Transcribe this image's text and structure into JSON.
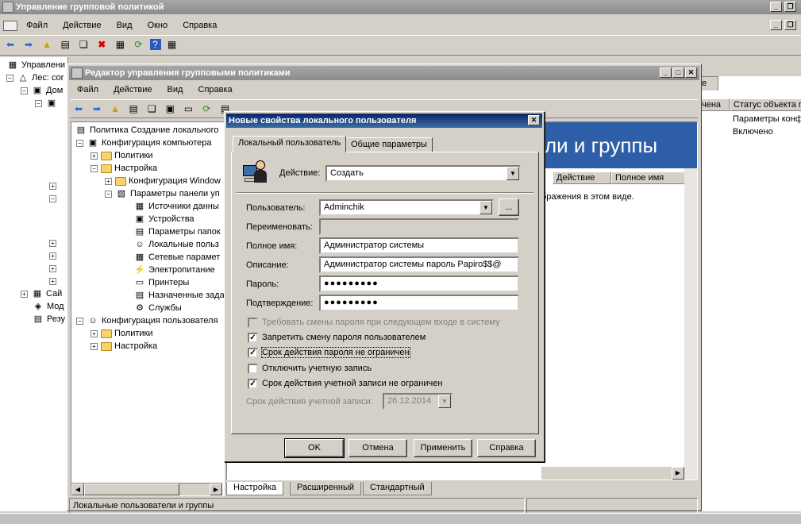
{
  "outer_window": {
    "title": "Управление групповой политикой",
    "menu": [
      "Файл",
      "Действие",
      "Вид",
      "Окно",
      "Справка"
    ],
    "tree": [
      "Управлени",
      "Лес: cor",
      "Дом",
      "Сай",
      "Мод",
      "Резу"
    ],
    "right_tab_fragment": "е",
    "right_columns": [
      "чена",
      "Статус объекта г"
    ],
    "right_rows": [
      [
        "",
        "Параметры конф"
      ],
      [
        "",
        "Включено"
      ]
    ]
  },
  "editor_window": {
    "title": "Редактор управления групповыми политиками",
    "menu": [
      "Файл",
      "Действие",
      "Вид",
      "Справка"
    ],
    "tree": {
      "root": "Политика Создание локального",
      "computer_config": "Конфигурация компьютера",
      "policies": "Политики",
      "settings": "Настройка",
      "windows_config": "Конфигурация Window",
      "control_panel": "Параметры панели уп",
      "data_sources": "Источники данны",
      "devices": "Устройства",
      "folder_options": "Параметры папок",
      "local_users": "Локальные польз",
      "network": "Сетевые парамет",
      "power": "Электропитание",
      "printers": "Принтеры",
      "scheduled": "Назначенные зада",
      "services": "Службы",
      "user_config": "Конфигурация пользователя",
      "user_policies": "Политики",
      "user_settings": "Настройка"
    },
    "right_header": "ли и группы",
    "columns": [
      "Действие",
      "Полное имя"
    ],
    "empty_message": "бражения в этом виде.",
    "bottom_tabs": [
      "Настройка",
      "Расширенный",
      "Стандартный"
    ],
    "status": "Локальные пользователи и группы"
  },
  "dialog": {
    "title": "Новые свойства локального пользователя",
    "close": "✕",
    "tabs": [
      "Локальный пользователь",
      "Общие параметры"
    ],
    "action_label": "Действие:",
    "action_value": "Создать",
    "user_label": "Пользователь:",
    "user_value": "Adminchik",
    "browse": "...",
    "rename_label": "Переименовать:",
    "rename_value": "",
    "fullname_label": "Полное имя:",
    "fullname_value": "Администратор системы",
    "description_label": "Описание:",
    "description_value": "Администратор системы пароль Papiro$$@",
    "password_label": "Пароль:",
    "password_value": "●●●●●●●●●",
    "confirm_label": "Подтверждение:",
    "confirm_value": "●●●●●●●●●",
    "checkboxes": [
      {
        "label": "Требовать смены пароля при следующем входе в систему",
        "checked": false,
        "disabled": true
      },
      {
        "label": "Запретить смену пароля пользователем",
        "checked": true,
        "disabled": false
      },
      {
        "label": "Срок действия пароля не ограничен",
        "checked": true,
        "disabled": false
      },
      {
        "label": "Отключить учетную запись",
        "checked": false,
        "disabled": false
      },
      {
        "label": "Срок действия учетной записи не ограничен",
        "checked": true,
        "disabled": false
      }
    ],
    "expiry_label": "Срок действия учетной записи:",
    "expiry_value": "26.12.2014",
    "buttons": [
      "OK",
      "Отмена",
      "Применить",
      "Справка"
    ]
  }
}
